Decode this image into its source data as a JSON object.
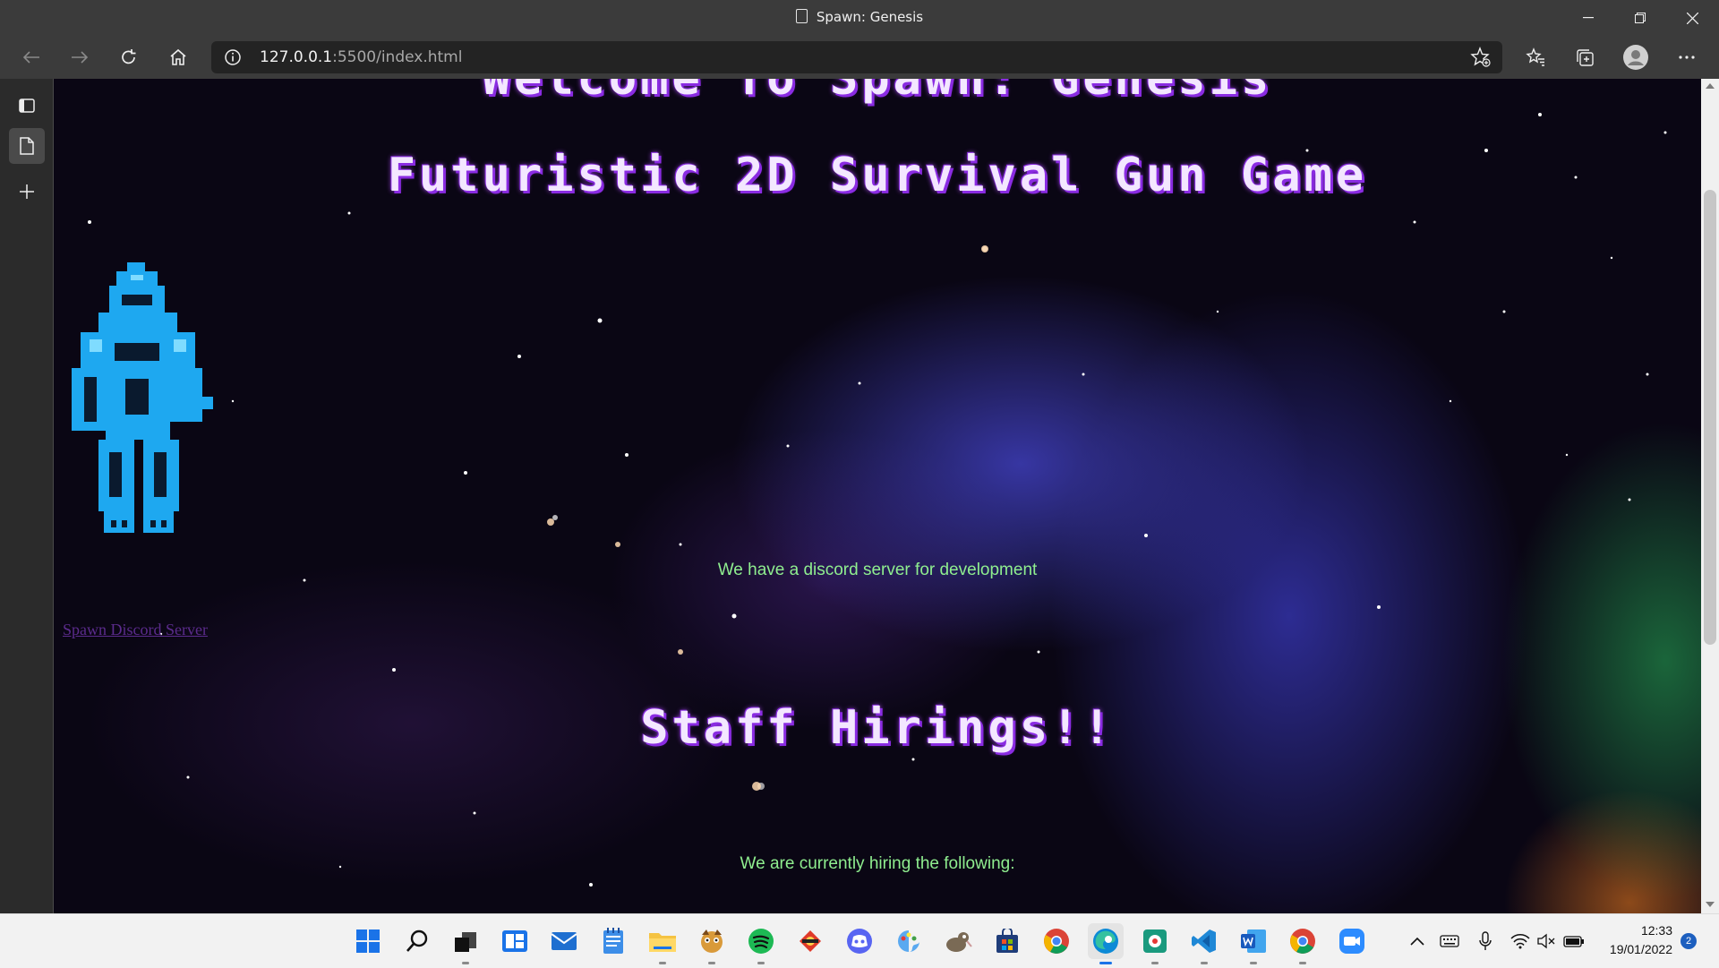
{
  "window": {
    "title": "Spawn: Genesis"
  },
  "toolbar": {
    "url_host": "127.0.0.1",
    "url_path": ":5500/index.html"
  },
  "page": {
    "heading_welcome": "Welcome To Spawn: Genesis",
    "heading_subtitle": "Futuristic 2D Survival Gun Game",
    "discord_text": "We have a discord server for development",
    "discord_link": "Spawn Discord Server",
    "staff_heading": "Staff Hirings!!",
    "hiring_text": "We are currently hiring the following:"
  },
  "taskbar": {
    "apps": [
      "start-icon",
      "search-icon",
      "task-view-icon",
      "widgets-icon",
      "mail-icon",
      "notepad-icon",
      "file-explorer-icon",
      "game-icon",
      "spotify-icon",
      "game2-icon",
      "discord-icon",
      "paint-icon",
      "gimp-icon",
      "store-icon",
      "chrome-icon",
      "edge-icon",
      "photos-icon",
      "vscode-icon",
      "word-icon",
      "chrome-profile-icon",
      "zoom-icon"
    ],
    "time": "12:33",
    "date": "19/01/2022",
    "notifications": "2"
  }
}
